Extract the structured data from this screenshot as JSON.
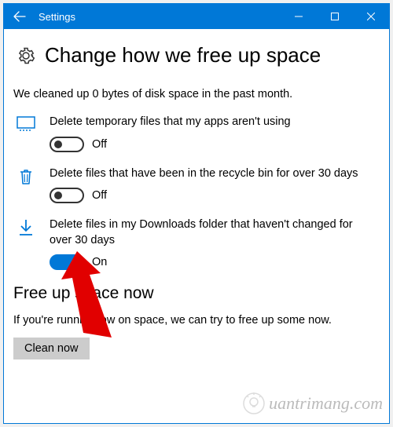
{
  "window": {
    "title": "Settings"
  },
  "page": {
    "heading": "Change how we free up space",
    "summary": "We cleaned up 0 bytes of disk space in the past month."
  },
  "options": [
    {
      "icon": "monitor-icon",
      "label": "Delete temporary files that my apps aren't using",
      "state": "Off",
      "on": false
    },
    {
      "icon": "trash-icon",
      "label": "Delete files that have been in the recycle bin for over 30 days",
      "state": "Off",
      "on": false
    },
    {
      "icon": "download-icon",
      "label": "Delete files in my Downloads folder that haven't changed for over 30 days",
      "state": "On",
      "on": true
    }
  ],
  "freeup": {
    "heading": "Free up space now",
    "desc": "If you're running low on space, we can try to free up some now.",
    "button": "Clean now"
  },
  "watermark": "uantrimang.com"
}
